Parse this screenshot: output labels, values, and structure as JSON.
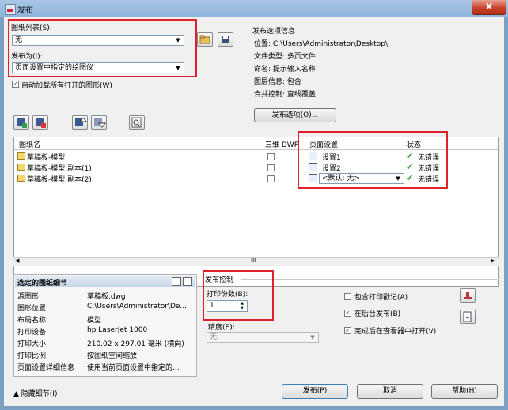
{
  "window": {
    "title": "发布",
    "close_glyph": "X"
  },
  "sheet_list": {
    "label": "图纸列表(S):",
    "value": "无"
  },
  "publish_to": {
    "label": "发布为(I):",
    "value": "页面设置中指定的绘图仪"
  },
  "auto_load": {
    "label": "自动加载所有打开的图形(W)",
    "checked": true
  },
  "publish_info": {
    "heading": "发布选项信息",
    "rows": [
      "位置: C:\\Users\\Administrator\\Desktop\\",
      "文件类型: 多页文件",
      "命名: 提示输入名称",
      "图层信息: 包含",
      "合并控制: 直线覆盖"
    ],
    "options_button": "发布选项(O)..."
  },
  "table": {
    "headers": {
      "name": "图纸名",
      "dwf3d": "三维 DWF",
      "page_setup": "页面设置",
      "status": "状态"
    },
    "rows": [
      {
        "name": "草稿板-模型",
        "setup": "设置1",
        "status": "无错误"
      },
      {
        "name": "草稿板-模型 副本(1)",
        "setup": "设置2",
        "status": "无错误"
      },
      {
        "name": "草稿板-模型 副本(2)",
        "setup": "<默认: 无>",
        "status": "无错误"
      }
    ],
    "scroll_glyph": "III"
  },
  "details": {
    "title": "选定的图纸细节",
    "rows": [
      {
        "label": "源图形",
        "value": "草稿板.dwg"
      },
      {
        "label": "图形位置",
        "value": "C:\\Users\\Administrator\\De..."
      },
      {
        "label": "布局名称",
        "value": "模型"
      },
      {
        "label": "打印设备",
        "value": "hp LaserJet 1000"
      },
      {
        "label": "打印大小",
        "value": "210.02 x 297.01 毫米 (横向)"
      },
      {
        "label": "打印比例",
        "value": "按图纸空间缩放"
      },
      {
        "label": "页面设置详细信息",
        "value": "使用当前页面设置中指定的..."
      }
    ]
  },
  "publish_control": {
    "title": "发布控制",
    "copies_label": "打印份数(B):",
    "copies_value": "1",
    "precision_label": "精度(E):",
    "precision_value": "无"
  },
  "options": {
    "include_stamp": {
      "label": "包含打印戳记(A)",
      "checked": false
    },
    "background": {
      "label": "在后台发布(B)",
      "checked": true
    },
    "open_viewer": {
      "label": "完成后在查看器中打开(V)",
      "checked": true
    }
  },
  "footer": {
    "hide_details": "隐藏细节(I)",
    "publish": "发布(P)",
    "cancel": "取消",
    "help": "帮助(H)"
  }
}
